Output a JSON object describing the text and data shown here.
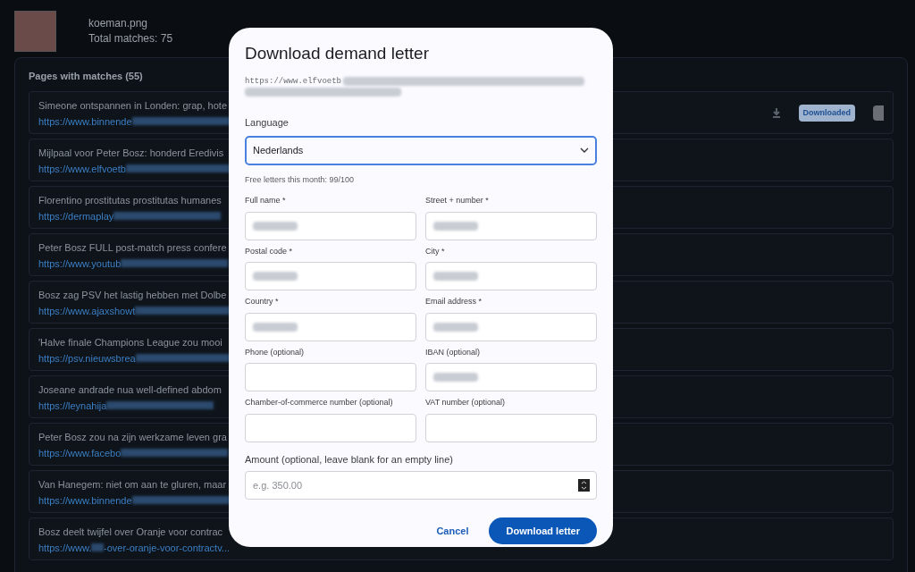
{
  "header": {
    "filename": "koeman.png",
    "total": "Total matches: 75"
  },
  "panel": {
    "title": "Pages with matches (55)",
    "rows": [
      {
        "title": "Simeone ontspannen in Londen: grap, hote",
        "url": "https://www.binnende",
        "downloaded": true,
        "badge": "Downloaded"
      },
      {
        "title": "Mijlpaal voor Peter Bosz: honderd Eredivis",
        "url": "https://www.elfvoetb",
        "downloaded": false
      },
      {
        "title": "Florentino prostitutas prostitutas humanes",
        "url": "https://dermaplay",
        "downloaded": false
      },
      {
        "title": "Peter Bosz FULL post-match press confere",
        "url": "https://www.youtub",
        "downloaded": false
      },
      {
        "title": "Bosz zag PSV het lastig hebben met Dolbe",
        "url": "https://www.ajaxshowt",
        "downloaded": false
      },
      {
        "title": "'Halve finale Champions League zou mooi",
        "url": "https://psv.nieuwsbrea",
        "downloaded": false
      },
      {
        "title": "Joseane andrade nua well-defined abdom",
        "url": "https://leynahija",
        "downloaded": false
      },
      {
        "title": "Peter Bosz zou na zijn werkzame leven gra",
        "url": "https://www.facebo",
        "downloaded": false
      },
      {
        "title": "Van Hanegem: niet om aan te gluren, maar",
        "url": "https://www.binnende",
        "downloaded": false
      },
      {
        "title": "Bosz deelt twijfel over Oranje voor contrac",
        "url": "https://www.",
        "url_tail": "-over-oranje-voor-contractv...",
        "downloaded": false
      }
    ]
  },
  "dialog": {
    "title": "Download demand letter",
    "url": "https://www.elfvoetb",
    "language_label": "Language",
    "language": "Nederlands",
    "quota": "Free letters this month: 99/100",
    "fields": [
      {
        "label": "Full name *",
        "redacted": true
      },
      {
        "label": "Street + number *",
        "redacted": true
      },
      {
        "label": "Postal code *",
        "redacted": true
      },
      {
        "label": "City *",
        "redacted": true
      },
      {
        "label": "Country *",
        "redacted": true
      },
      {
        "label": "Email address *",
        "redacted": true
      },
      {
        "label": "Phone (optional)",
        "redacted": false
      },
      {
        "label": "IBAN (optional)",
        "redacted": true
      },
      {
        "label": "Chamber-of-commerce number (optional)",
        "redacted": false
      },
      {
        "label": "VAT number (optional)",
        "redacted": false
      }
    ],
    "amount_label": "Amount (optional, leave blank for an empty line)",
    "amount_placeholder": "e.g. 350.00",
    "cancel": "Cancel",
    "submit": "Download letter"
  }
}
